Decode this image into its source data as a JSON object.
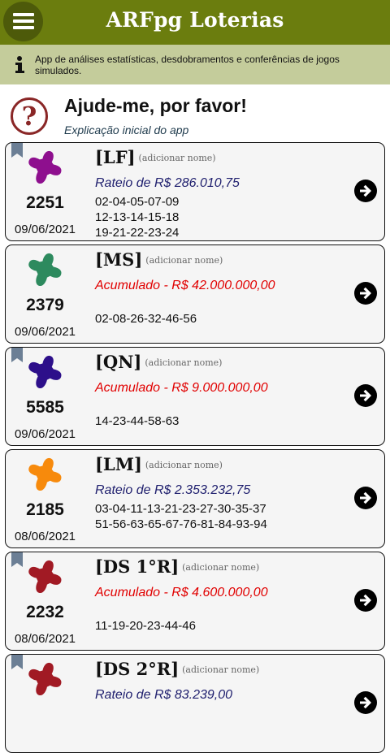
{
  "app": {
    "title": "ARFpg Loterias",
    "info_text": "App de análises estatísticas, desdobramentos e conferências de jogos simulados."
  },
  "help": {
    "title": "Ajude-me, por favor!",
    "subtitle": "Explicação inicial do app"
  },
  "colors": {
    "appbar": "#6b7d0e",
    "infobar": "#c4cc9b",
    "rateio": "#1f1f6e",
    "acumulado": "#e10000"
  },
  "cards": [
    {
      "code": "[LF]",
      "add_name": "(adicionar nome)",
      "contest": "2251",
      "date": "09/06/2021",
      "prize": "Rateio de R$ 286.010,75",
      "prize_kind": "rateio",
      "numbers": [
        "02-04-05-07-09",
        "12-13-14-15-18",
        "19-21-22-23-24"
      ],
      "star_color": "#8e0f8e",
      "bookmarked": true
    },
    {
      "code": "[MS]",
      "add_name": "(adicionar nome)",
      "contest": "2379",
      "date": "09/06/2021",
      "prize": "Acumulado - R$ 42.000.000,00",
      "prize_kind": "acumulado",
      "numbers": [
        "02-08-26-32-46-56"
      ],
      "star_color": "#2d8a5e",
      "bookmarked": false
    },
    {
      "code": "[QN]",
      "add_name": "(adicionar nome)",
      "contest": "5585",
      "date": "09/06/2021",
      "prize": "Acumulado - R$ 9.000.000,00",
      "prize_kind": "acumulado",
      "numbers": [
        "14-23-44-58-63"
      ],
      "star_color": "#2d0f8a",
      "bookmarked": true
    },
    {
      "code": "[LM]",
      "add_name": "(adicionar nome)",
      "contest": "2185",
      "date": "08/06/2021",
      "prize": "Rateio de R$ 2.353.232,75",
      "prize_kind": "rateio",
      "numbers": [
        "03-04-11-13-21-23-27-30-35-37",
        "51-56-63-65-67-76-81-84-93-94"
      ],
      "star_color": "#f78a0c",
      "bookmarked": false
    },
    {
      "code": "[DS 1°R]",
      "add_name": "(adicionar nome)",
      "contest": "2232",
      "date": "08/06/2021",
      "prize": "Acumulado - R$ 4.600.000,00",
      "prize_kind": "acumulado",
      "numbers": [
        "11-19-20-23-44-46"
      ],
      "star_color": "#a11a24",
      "bookmarked": true
    },
    {
      "code": "[DS 2°R]",
      "add_name": "(adicionar nome)",
      "contest": "",
      "date": "",
      "prize": "Rateio de R$ 83.239,00",
      "prize_kind": "rateio",
      "numbers": [],
      "star_color": "#a11a24",
      "bookmarked": true
    }
  ]
}
